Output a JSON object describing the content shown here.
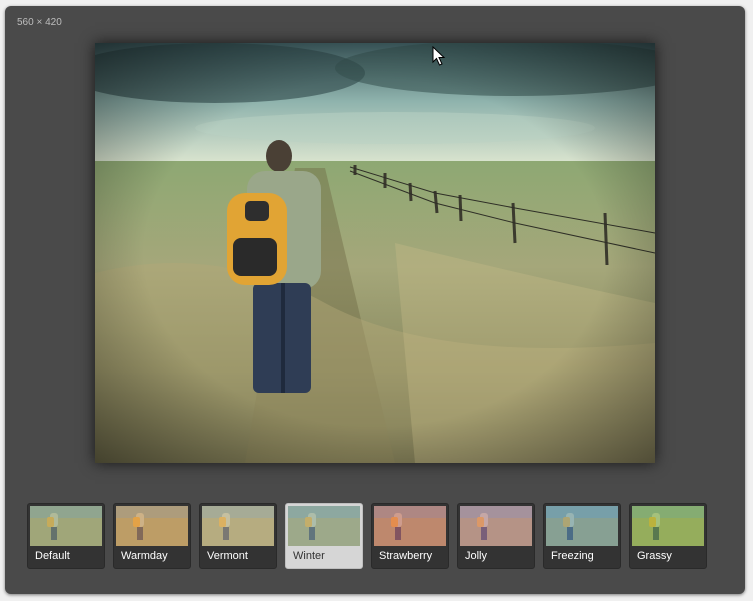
{
  "image_info": {
    "dimensions_label": "560 × 420"
  },
  "filters": [
    {
      "name": "Default",
      "tint": "#a7b48a"
    },
    {
      "name": "Warmday",
      "tint": "#e6a060"
    },
    {
      "name": "Vermont",
      "tint": "#d8c29a"
    },
    {
      "name": "Winter",
      "tint": "#9fbab0"
    },
    {
      "name": "Strawberry",
      "tint": "#e8706e"
    },
    {
      "name": "Jolly",
      "tint": "#d48aa6"
    },
    {
      "name": "Freezing",
      "tint": "#6fa6c4"
    },
    {
      "name": "Grassy",
      "tint": "#8fc44a"
    }
  ],
  "selected_filter": "Winter",
  "colors": {
    "panel": "#4a4a4a",
    "thumb_bg": "#333333",
    "thumb_active_bg": "#d6d6d6"
  }
}
